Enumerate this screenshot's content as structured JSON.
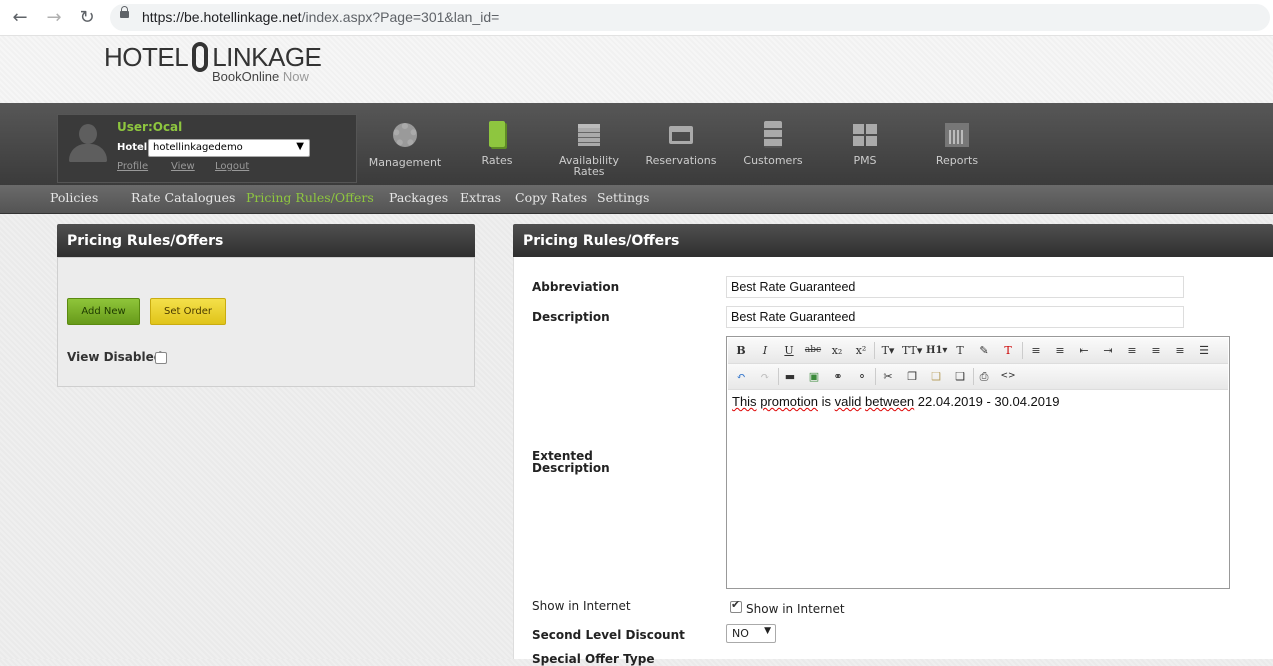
{
  "browser": {
    "url_host": "https://be.hotellinkage.net",
    "url_path": "/index.aspx?Page=301&lan_id="
  },
  "logo": {
    "left": "HOTEL",
    "right": "LINKAGE",
    "sub": "BookOnline",
    "sub_suffix": "Now"
  },
  "user": {
    "name": "User:Ocal",
    "hotel_label": "Hotel",
    "hotel_value": "hotellinkagedemo",
    "links": [
      "Profile",
      "View",
      "Logout"
    ]
  },
  "main_nav": [
    {
      "label": "Management",
      "icon": "gear-icon"
    },
    {
      "label": "Rates",
      "icon": "book-icon"
    },
    {
      "label": "Availability",
      "label2": "Rates",
      "icon": "calendar-icon"
    },
    {
      "label": "Reservations",
      "icon": "inbox-tray-icon"
    },
    {
      "label": "Customers",
      "icon": "file-cabinet-icon"
    },
    {
      "label": "PMS",
      "icon": "grid-icon"
    },
    {
      "label": "Reports",
      "icon": "bar-chart-icon"
    }
  ],
  "sub_nav": [
    "Policies",
    "Rate Catalogues",
    "Pricing Rules/Offers",
    "Packages",
    "Extras",
    "Copy Rates",
    "Settings"
  ],
  "sub_nav_active": "Pricing Rules/Offers",
  "left_panel": {
    "title": "Pricing Rules/Offers",
    "add_new": "Add New",
    "set_order": "Set Order",
    "view_disabled": "View Disabled"
  },
  "right_panel": {
    "title": "Pricing Rules/Offers",
    "abbreviation_label": "Abbreviation",
    "abbreviation_value": "Best Rate Guaranteed",
    "description_label": "Description",
    "description_value": "Best Rate Guaranteed",
    "extended_label_1": "Extented",
    "extended_label_2": "Description",
    "editor_words": [
      "This",
      "promotion",
      "is",
      "valid",
      "between",
      "22.04.2019 - 30.04.2019"
    ],
    "show_internet_label": "Show in Internet",
    "show_internet_check_label": "Show in Internet",
    "second_level_label": "Second Level Discount",
    "second_level_value": "NO",
    "special_offer_label": "Special Offer Type"
  },
  "colors": {
    "accent_green": "#8ec63f",
    "header_dark": "#3b3b3b",
    "button_yellow": "#e0c41a"
  }
}
